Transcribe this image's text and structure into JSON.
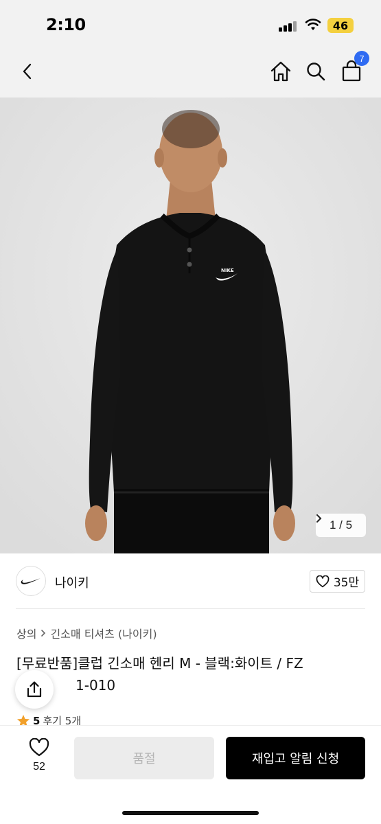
{
  "status_bar": {
    "time": "2:10",
    "battery": "46",
    "battery_color": "#f4d03f"
  },
  "nav": {
    "back_icon": "chevron-left-icon",
    "home_icon": "home-icon",
    "search_icon": "search-icon",
    "cart_icon": "shopping-bag-icon",
    "cart_count": "7",
    "badge_color": "#2f6bf2"
  },
  "gallery": {
    "current": "1",
    "total": "5",
    "pager_text": "1 / 5"
  },
  "brand": {
    "name": "나이키",
    "logo_icon": "nike-swoosh-logo",
    "likes": "35만"
  },
  "breadcrumb": {
    "items": [
      "상의",
      "긴소매 티셔츠 (나이키)"
    ]
  },
  "product": {
    "title": "[무료반품]클럽 긴소매 헨리 M - 블랙:화이트 / FZ",
    "title_line2": "1-010",
    "rating": "5",
    "review_text": "후기 5개"
  },
  "actions": {
    "wish_count": "52",
    "soldout_label": "품절",
    "notify_label": "재입고 알림 신청"
  }
}
